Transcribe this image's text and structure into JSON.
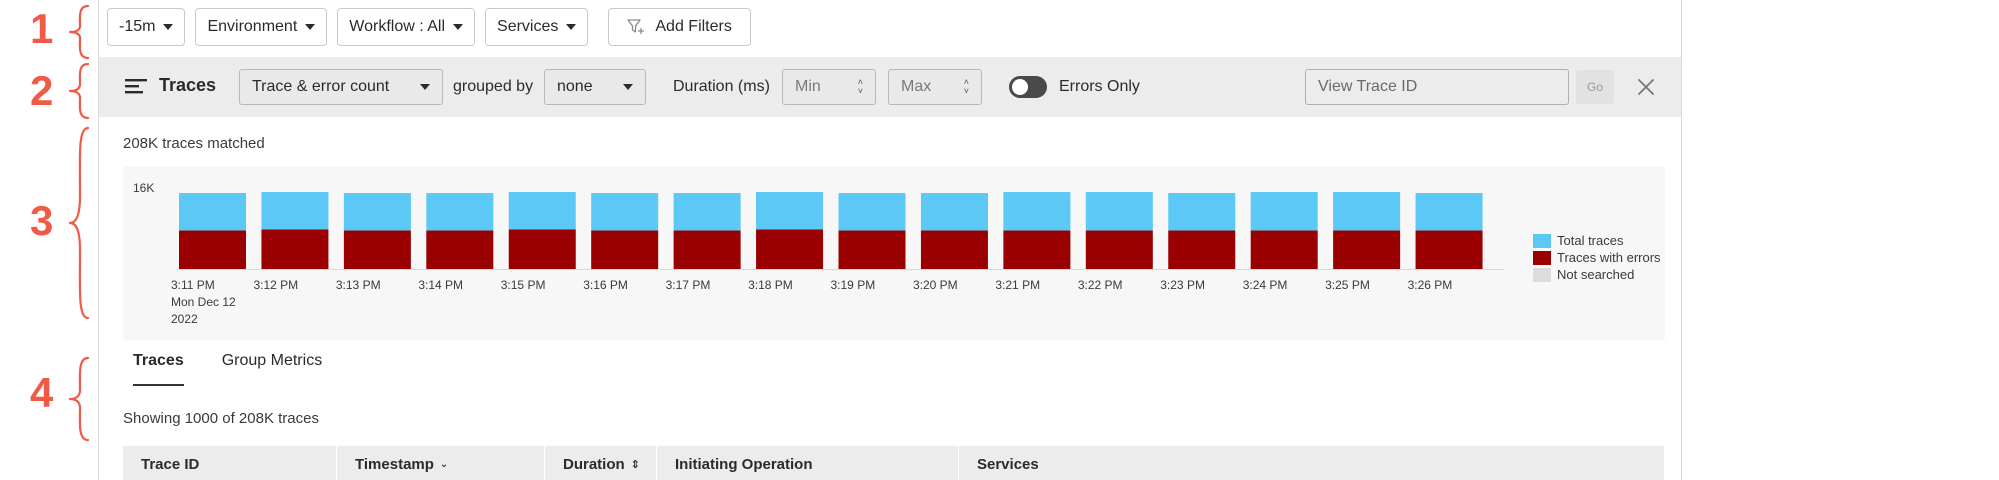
{
  "annotations": [
    "1",
    "2",
    "3",
    "4"
  ],
  "filters": {
    "time": "-15m",
    "environment": "Environment",
    "workflow": "Workflow : All",
    "services": "Services",
    "add_filters": "Add Filters"
  },
  "toolbar": {
    "title": "Traces",
    "metric": "Trace & error count",
    "grouped_by_label": "grouped by",
    "group_value": "none",
    "duration_label": "Duration (ms)",
    "min_placeholder": "Min",
    "max_placeholder": "Max",
    "errors_only_label": "Errors Only",
    "trace_id_placeholder": "View Trace ID",
    "go_label": "Go"
  },
  "summary": {
    "matched": "208K traces matched"
  },
  "chart_data": {
    "type": "bar",
    "stacked": true,
    "y_tick_labels": [
      "16K"
    ],
    "ylim": [
      0,
      16000
    ],
    "categories": [
      "3:11 PM",
      "3:12 PM",
      "3:13 PM",
      "3:14 PM",
      "3:15 PM",
      "3:16 PM",
      "3:17 PM",
      "3:18 PM",
      "3:19 PM",
      "3:20 PM",
      "3:21 PM",
      "3:22 PM",
      "3:23 PM",
      "3:24 PM",
      "3:25 PM",
      "3:26 PM"
    ],
    "first_tick_sublabel": [
      "Mon Dec 12",
      "2022"
    ],
    "series": [
      {
        "name": "Traces with errors",
        "color": "#9b0000",
        "values": [
          7600,
          7800,
          7600,
          7600,
          7800,
          7600,
          7600,
          7800,
          7600,
          7600,
          7600,
          7600,
          7600,
          7600,
          7600,
          7600
        ]
      },
      {
        "name": "Total traces",
        "color": "#5bc8f5",
        "values": [
          15000,
          15200,
          15000,
          15000,
          15200,
          15000,
          15000,
          15200,
          15000,
          15000,
          15200,
          15200,
          15000,
          15200,
          15200,
          15000
        ]
      }
    ],
    "legend": [
      {
        "name": "Total traces",
        "color": "#5bc8f5"
      },
      {
        "name": "Traces with errors",
        "color": "#9b0000"
      },
      {
        "name": "Not searched",
        "color": "#dcdcdc"
      }
    ],
    "legend_position": "right"
  },
  "tabs": [
    "Traces",
    "Group Metrics"
  ],
  "results": {
    "showing": "Showing 1000 of 208K traces"
  },
  "table": {
    "columns": [
      "Trace ID",
      "Timestamp",
      "Duration",
      "Initiating Operation",
      "Services"
    ]
  }
}
